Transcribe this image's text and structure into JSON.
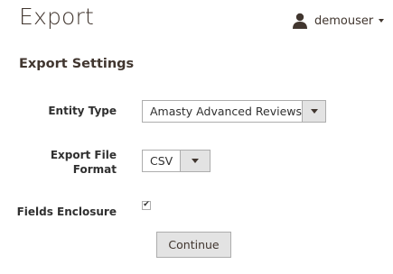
{
  "header": {
    "title": "Export",
    "user": {
      "name": "demouser",
      "icon": "user-icon"
    }
  },
  "section": {
    "title": "Export Settings"
  },
  "form": {
    "entity_type": {
      "label": "Entity Type",
      "selected": "Amasty Advanced Reviews"
    },
    "export_file_format": {
      "label": "Export File Format",
      "selected": "CSV"
    },
    "fields_enclosure": {
      "label": "Fields Enclosure",
      "checked": true,
      "check_glyph": "✔"
    }
  },
  "actions": {
    "continue_label": "Continue"
  }
}
